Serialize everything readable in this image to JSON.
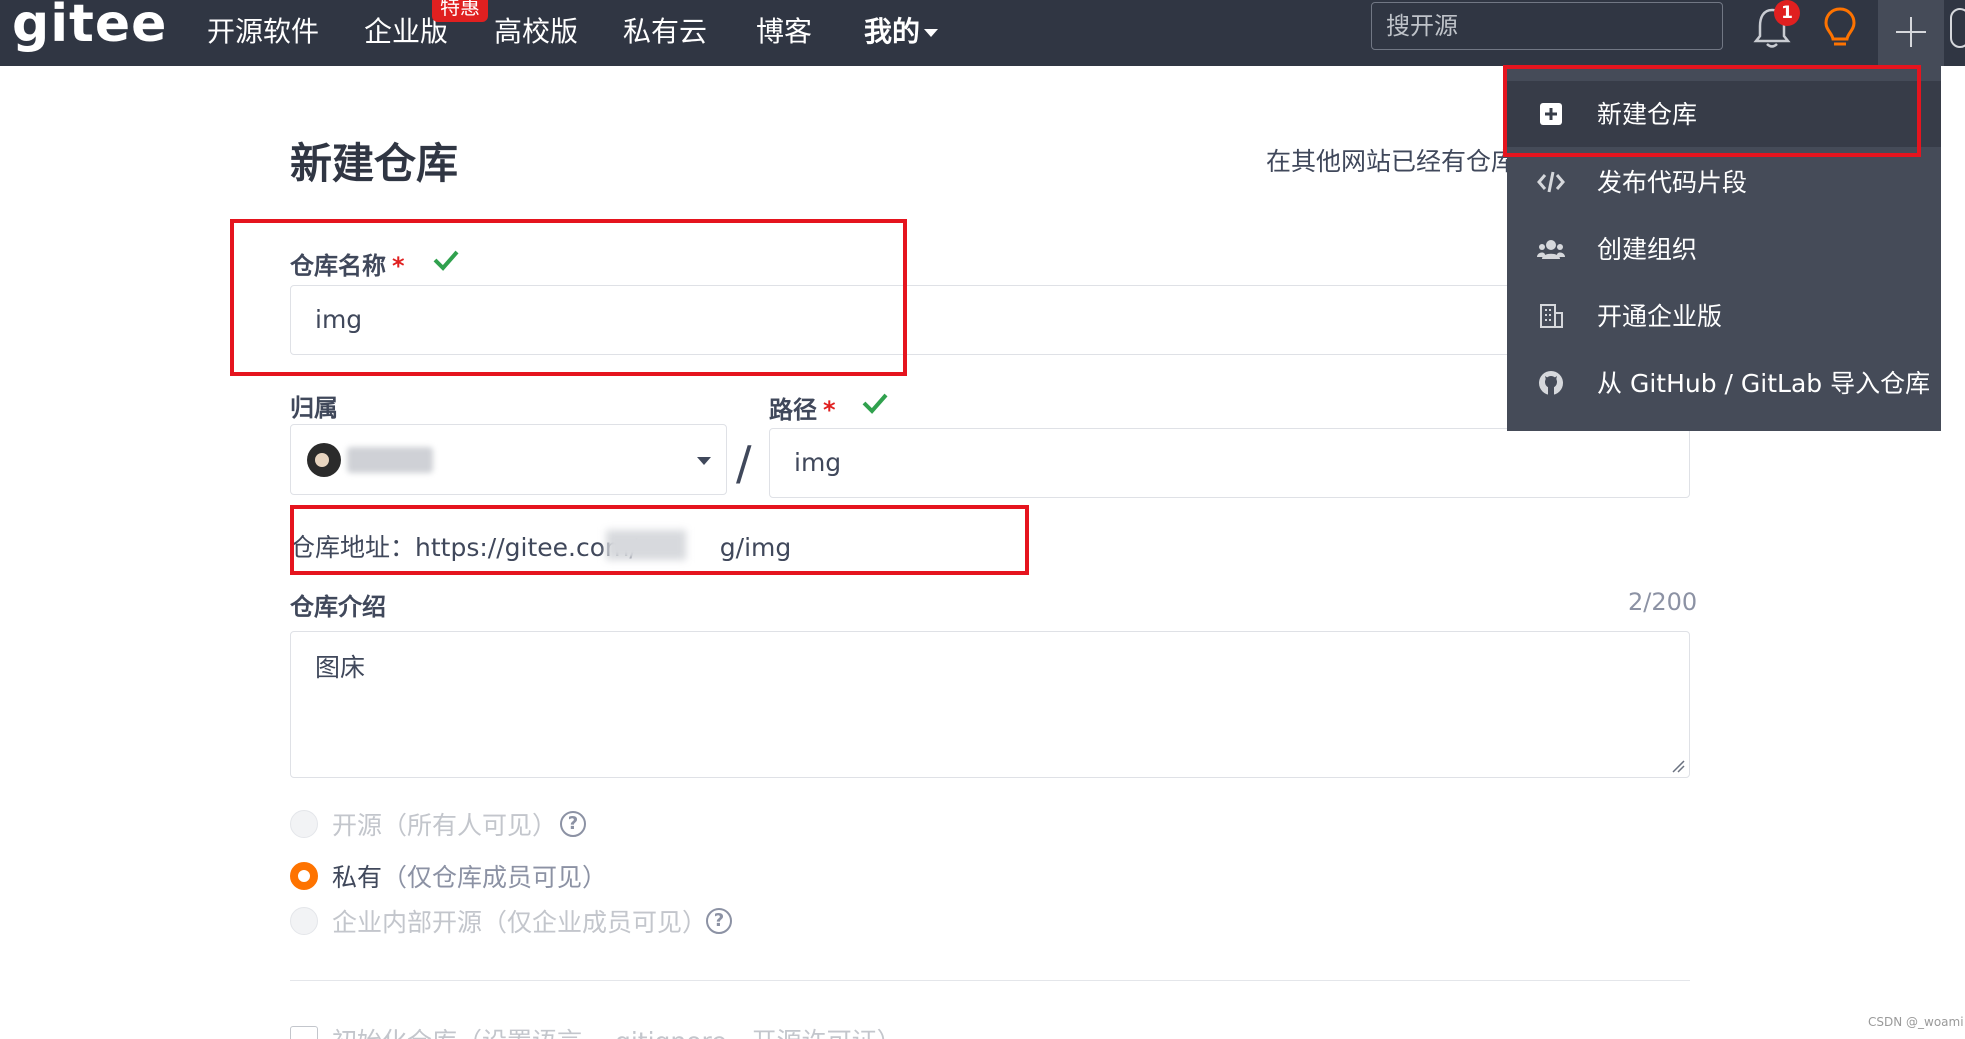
{
  "topnav": {
    "logo": "gitee",
    "items": [
      "开源软件",
      "企业版",
      "高校版",
      "私有云",
      "博客",
      "我的"
    ],
    "badge": "特惠",
    "search_placeholder": "搜开源",
    "notification_count": "1"
  },
  "page": {
    "title": "新建仓库",
    "import_hint": "在其他网站已经有仓库"
  },
  "form": {
    "repo_name_label": "仓库名称",
    "required_mark": "*",
    "repo_name_value": "img",
    "owner_label": "归属",
    "path_label": "路径",
    "path_value": "img",
    "separator": "/",
    "repo_url_label": "仓库地址：",
    "repo_url_prefix": "https://gitee.com/",
    "repo_url_suffix": "g/img",
    "intro_label": "仓库介绍",
    "intro_counter": "2/200",
    "intro_value": "图床",
    "visibility": [
      {
        "label": "开源",
        "desc": "（所有人可见）",
        "selected": false,
        "enabled": false
      },
      {
        "label": "私有",
        "desc": "（仅仓库成员可见）",
        "selected": true,
        "enabled": true
      },
      {
        "label": "企业内部开源",
        "desc": "（仅企业成员可见）",
        "selected": false,
        "enabled": false
      }
    ],
    "init_label": "初始化仓库（设置语言、.gitignore、开源许可证）"
  },
  "dropdown": {
    "items": [
      "新建仓库",
      "发布代码片段",
      "创建组织",
      "开通企业版",
      "从 GitHub / GitLab 导入仓库"
    ]
  },
  "watermark": "CSDN @_woami",
  "colors": {
    "nav_bg": "#303643",
    "accent_orange": "#fe7300",
    "check_green": "#30a14e",
    "highlight_red": "#e5141e"
  }
}
